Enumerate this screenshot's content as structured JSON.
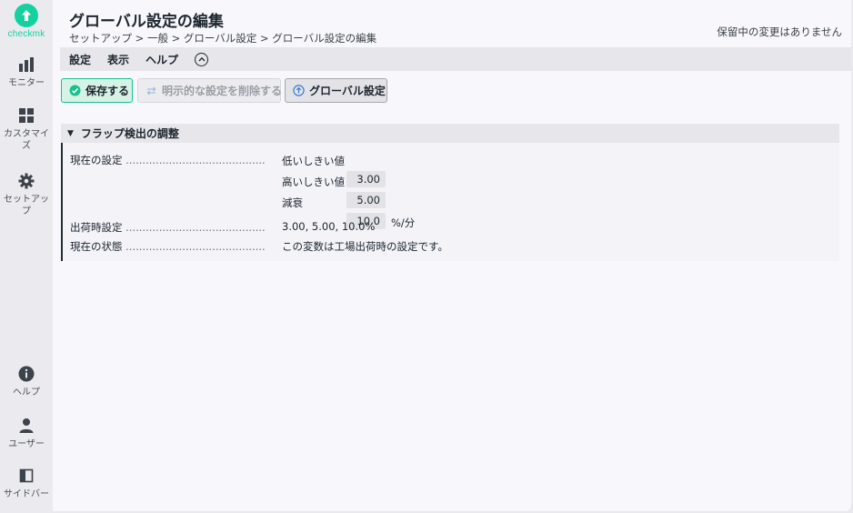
{
  "brand": {
    "name": "checkmk",
    "color": "#15d1a0"
  },
  "sidebar": {
    "top_items": [
      {
        "label": "モニター",
        "icon": "bar-chart-icon"
      },
      {
        "label": "カスタマイズ",
        "icon": "grid-icon"
      },
      {
        "label": "セットアップ",
        "icon": "gear-icon"
      }
    ],
    "bottom_items": [
      {
        "label": "ヘルプ",
        "icon": "info-icon"
      },
      {
        "label": "ユーザー",
        "icon": "user-icon"
      },
      {
        "label": "サイドバー",
        "icon": "sidebar-icon"
      }
    ]
  },
  "header": {
    "title": "グローバル設定の編集",
    "breadcrumb": "セットアップ > 一般 > グローバル設定 > グローバル設定の編集",
    "pending": "保留中の変更はありません"
  },
  "menu": {
    "items": [
      "設定",
      "表示",
      "ヘルプ"
    ]
  },
  "toolbar": {
    "save": "保存する",
    "remove_explicit": "明示的な設定を削除する",
    "global_settings": "グローバル設定"
  },
  "section": {
    "title": "フラップ検出の調整",
    "current_setting_label": "現在の設定",
    "low_threshold_label": "低いしきい値",
    "low_threshold_value": "3.00",
    "high_threshold_label": "高いしきい値",
    "high_threshold_value": "5.00",
    "decay_label": "減衰",
    "decay_value": "10.0",
    "decay_unit": "%/分",
    "factory_label": "出荷時設定",
    "factory_value": "3.00, 5.00, 10.0%",
    "status_label": "現在の状態",
    "status_value": "この変数は工場出荷時の設定です。"
  },
  "colors": {
    "accent": "#15d1a0",
    "save_border": "#15c28d"
  }
}
